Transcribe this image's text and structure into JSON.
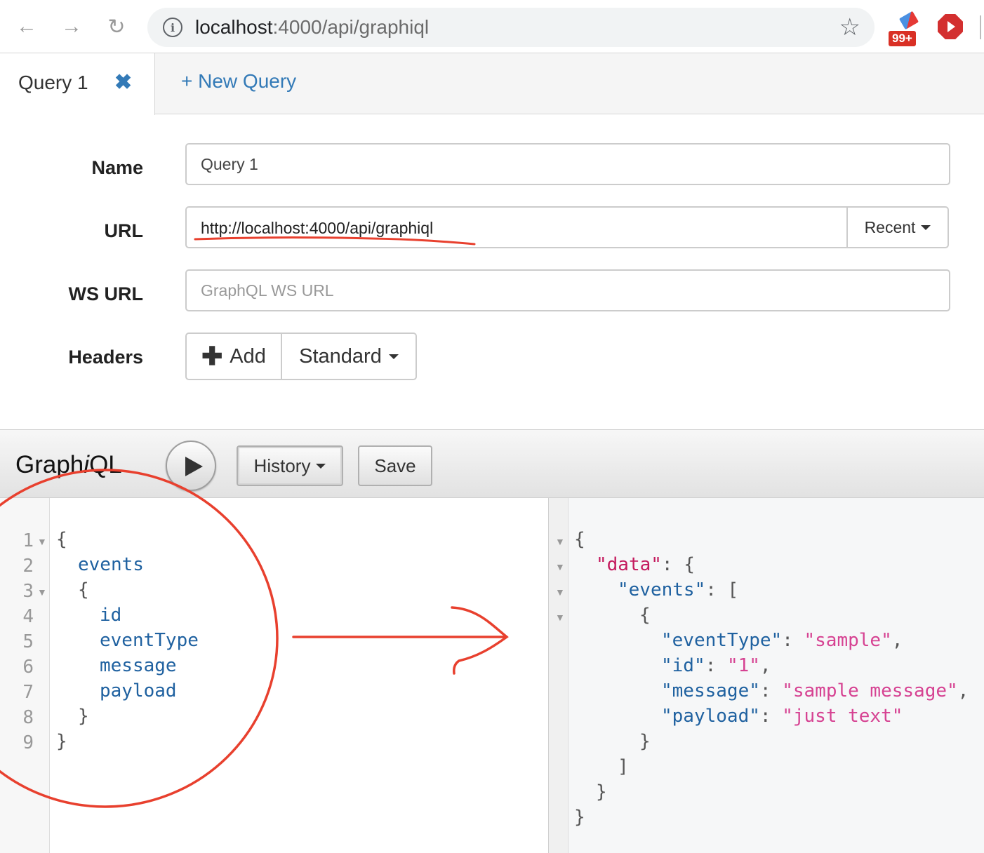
{
  "browser": {
    "url_host": "localhost",
    "url_rest": ":4000/api/graphiql",
    "extension_badge": "99+"
  },
  "tabs": {
    "active_label": "Query 1",
    "new_label": "+ New Query"
  },
  "form": {
    "name_label": "Name",
    "name_value": "Query 1",
    "url_label": "URL",
    "url_value": "http://localhost:4000/api/graphiql",
    "recent_label": "Recent",
    "ws_url_label": "WS URL",
    "ws_url_placeholder": "GraphQL WS URL",
    "headers_label": "Headers",
    "add_label": "Add",
    "standard_label": "Standard"
  },
  "graphiql": {
    "title_prefix": "Graph",
    "title_italic": "i",
    "title_suffix": "QL",
    "history_label": "History",
    "save_label": "Save"
  },
  "query_lines": [
    {
      "num": "1",
      "text": "{"
    },
    {
      "num": "2",
      "text": "events"
    },
    {
      "num": "3",
      "text": "{"
    },
    {
      "num": "4",
      "text": "id"
    },
    {
      "num": "5",
      "text": "eventType"
    },
    {
      "num": "6",
      "text": "message"
    },
    {
      "num": "7",
      "text": "payload"
    },
    {
      "num": "8",
      "text": "}"
    },
    {
      "num": "9",
      "text": "}"
    }
  ],
  "result": {
    "data_key": "\"data\"",
    "events_key": "\"events\"",
    "event_type_key": "\"eventType\"",
    "event_type_value": "\"sample\"",
    "id_key": "\"id\"",
    "id_value": "\"1\"",
    "message_key": "\"message\"",
    "message_value": "\"sample message\"",
    "payload_key": "\"payload\"",
    "payload_value": "\"just text\""
  },
  "colors": {
    "link_blue": "#337ab7",
    "annotation_red": "#e8402e",
    "json_string": "#d64292",
    "field_blue": "#1f61a0"
  }
}
